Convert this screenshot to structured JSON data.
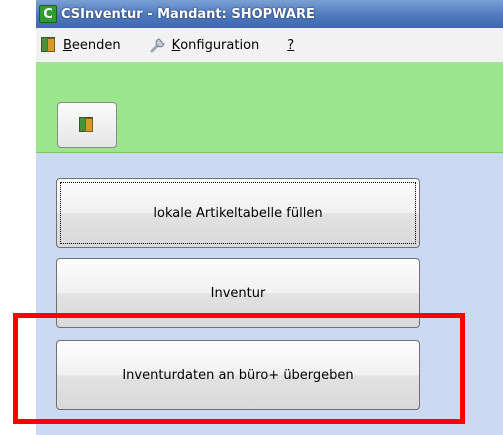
{
  "window": {
    "title": "CSInventur - Mandant: SHOPWARE",
    "app_icon_letter": "C"
  },
  "menu": {
    "items": [
      {
        "label_underlined": "B",
        "label_rest": "eenden",
        "icon": "exit-door-icon"
      },
      {
        "label_underlined": "K",
        "label_rest": "onfiguration",
        "icon": "wrench-icon"
      },
      {
        "label_underlined": "?",
        "label_rest": "",
        "icon": null
      }
    ]
  },
  "toolbar": {
    "exit_icon": "exit-door-icon"
  },
  "buttons": {
    "fill_table": "lokale Artikeltabelle füllen",
    "inventory": "Inventur",
    "transfer": "Inventurdaten an büro+ übergeben"
  },
  "colors": {
    "titlebar": "#4f79bd",
    "greenbar": "#9be58d",
    "background": "#ccd9f2",
    "highlight": "#ff0000"
  }
}
